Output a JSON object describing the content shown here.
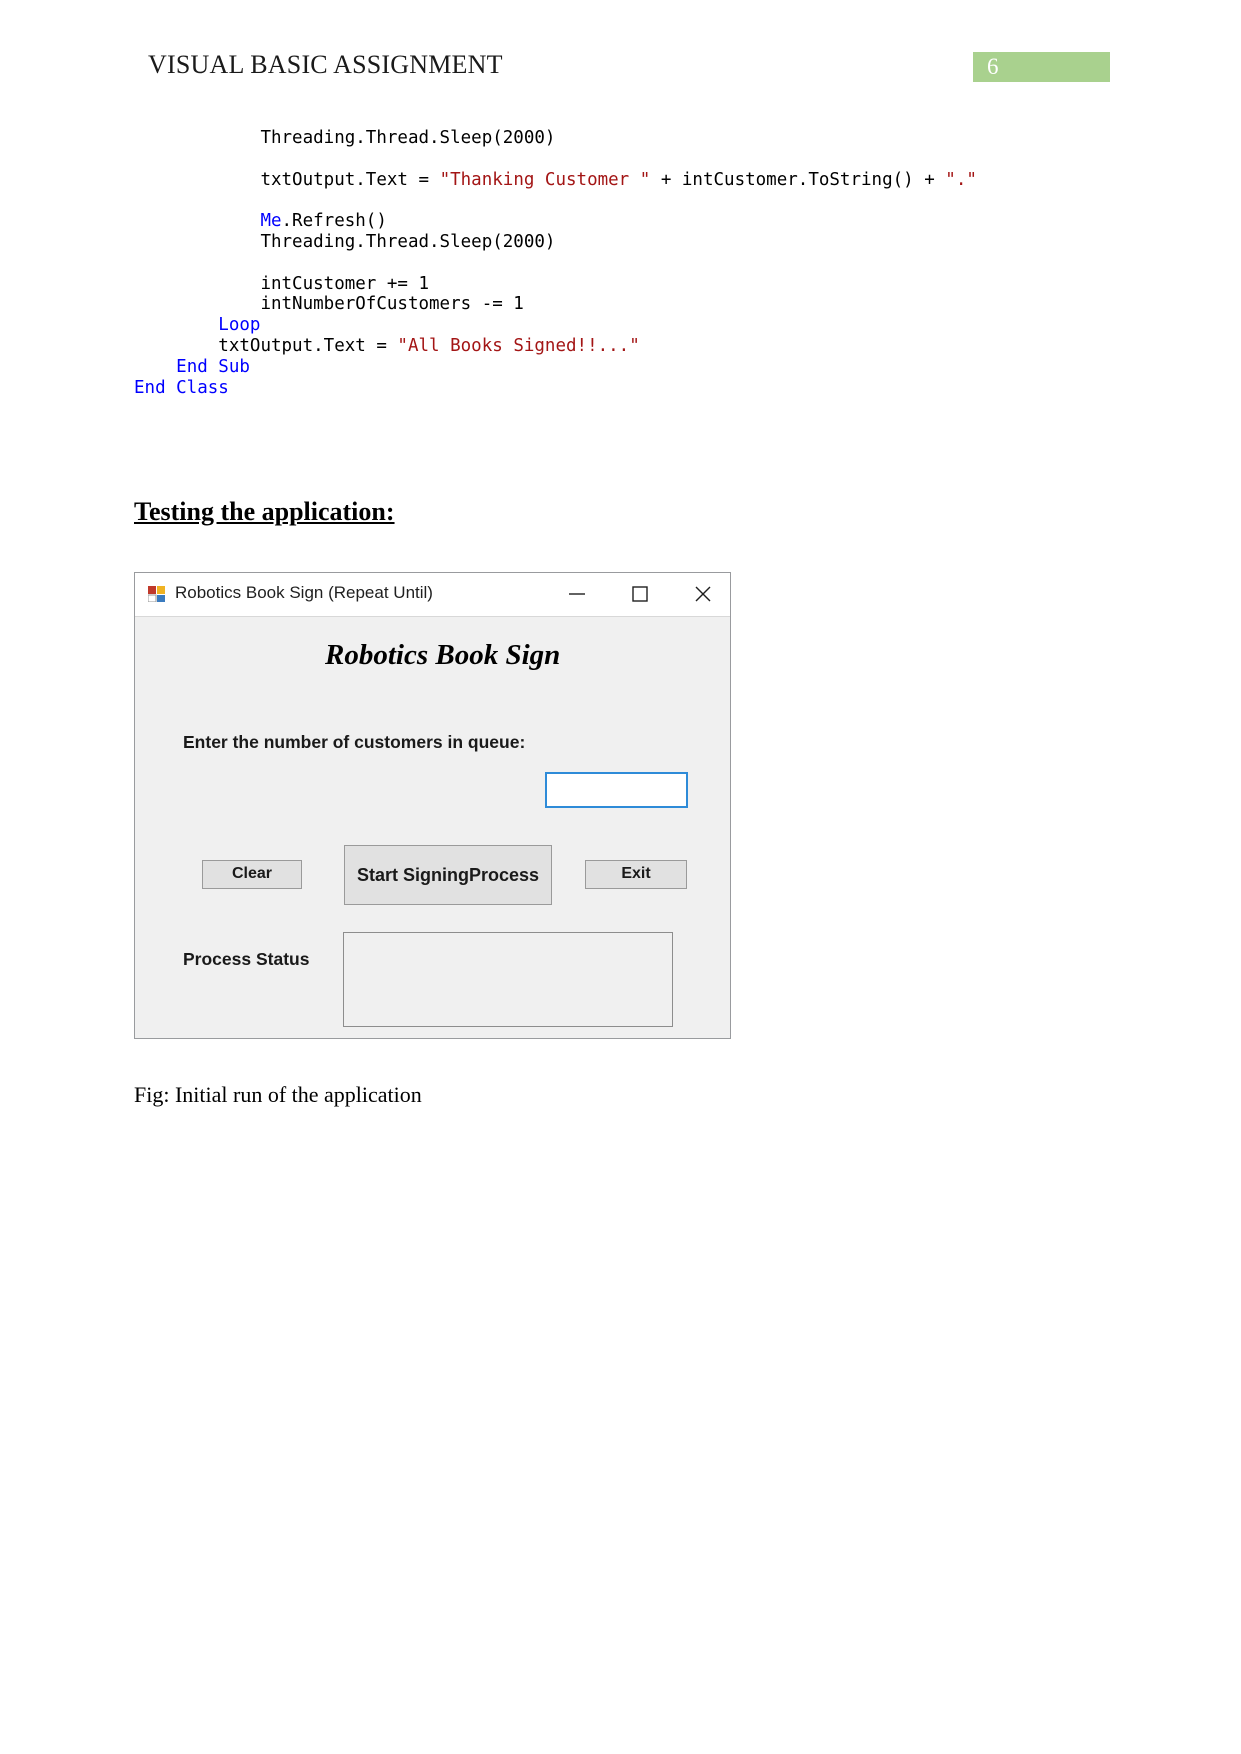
{
  "header": {
    "title": "VISUAL BASIC ASSIGNMENT",
    "page_number": "6",
    "badge_color": "#a9d18e"
  },
  "code": {
    "language": "Visual Basic",
    "keyword_color": "#0000ff",
    "string_color": "#a31515",
    "lines": [
      {
        "id": "l1",
        "segments": [
          {
            "t": "plain",
            "text": "            Threading.Thread.Sleep(2000)"
          }
        ]
      },
      {
        "id": "l2",
        "segments": [
          {
            "t": "plain",
            "text": ""
          }
        ]
      },
      {
        "id": "l3",
        "segments": [
          {
            "t": "plain",
            "text": "            txtOutput.Text = "
          },
          {
            "t": "str",
            "text": "\"Thanking Customer \""
          },
          {
            "t": "plain",
            "text": " + intCustomer.ToString() + "
          },
          {
            "t": "str",
            "text": "\".\""
          }
        ]
      },
      {
        "id": "l4",
        "segments": [
          {
            "t": "plain",
            "text": ""
          }
        ]
      },
      {
        "id": "l5",
        "segments": [
          {
            "t": "kw",
            "text": "            Me"
          },
          {
            "t": "plain",
            "text": ".Refresh()"
          }
        ]
      },
      {
        "id": "l6",
        "segments": [
          {
            "t": "plain",
            "text": "            Threading.Thread.Sleep(2000)"
          }
        ]
      },
      {
        "id": "l7",
        "segments": [
          {
            "t": "plain",
            "text": ""
          }
        ]
      },
      {
        "id": "l8",
        "segments": [
          {
            "t": "plain",
            "text": "            intCustomer += 1"
          }
        ]
      },
      {
        "id": "l9",
        "segments": [
          {
            "t": "plain",
            "text": "            intNumberOfCustomers -= 1"
          }
        ]
      },
      {
        "id": "l10",
        "segments": [
          {
            "t": "kw",
            "text": "        Loop"
          }
        ]
      },
      {
        "id": "l11",
        "segments": [
          {
            "t": "plain",
            "text": "        txtOutput.Text = "
          },
          {
            "t": "str",
            "text": "\"All Books Signed!!...\""
          }
        ]
      },
      {
        "id": "l12",
        "segments": [
          {
            "t": "kw",
            "text": "    End Sub"
          }
        ]
      },
      {
        "id": "l13",
        "segments": [
          {
            "t": "kw",
            "text": "End Class"
          }
        ]
      }
    ]
  },
  "section": {
    "heading": "Testing the application:"
  },
  "app_window": {
    "title": "Robotics Book Sign (Repeat Until)",
    "icon": "vb-form-icon",
    "window_buttons": [
      {
        "name": "minimize",
        "glyph": "minimize-icon"
      },
      {
        "name": "maximize",
        "glyph": "maximize-icon"
      },
      {
        "name": "close",
        "glyph": "close-icon"
      }
    ],
    "form": {
      "title": "Robotics Book Sign",
      "prompt_label": "Enter the number of customers in queue:",
      "input_value": "",
      "input_border_color": "#2e8bd8",
      "buttons": {
        "clear": "Clear",
        "start": "Start Signing\nProcess",
        "start_line1": "Start Signing",
        "start_line2": "Process",
        "exit": "Exit"
      },
      "status_label": "Process Status",
      "status_value": ""
    }
  },
  "figure": {
    "caption": "Fig: Initial run of the application"
  }
}
